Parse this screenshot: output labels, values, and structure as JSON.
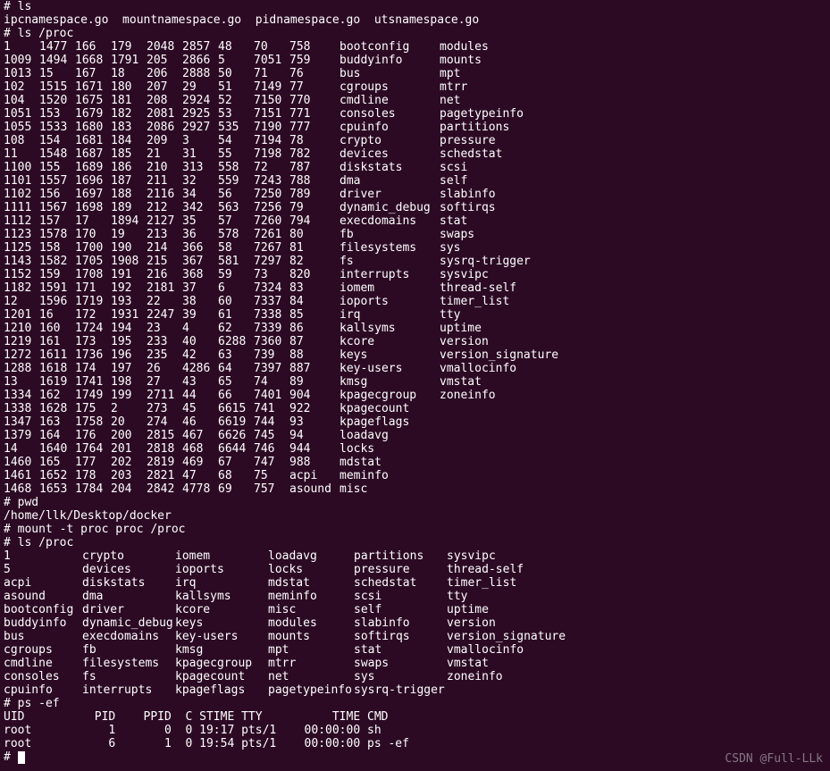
{
  "top_lines": [
    "# ls",
    "ipcnamespace.go  mountnamespace.go  pidnamespace.go  utsnamespace.go",
    "# ls /proc"
  ],
  "proc_cols": [
    [
      "1",
      "1009",
      "1013",
      "102",
      "104",
      "1051",
      "1055",
      "108",
      "11",
      "1100",
      "1101",
      "1102",
      "1111",
      "1112",
      "1123",
      "1125",
      "1143",
      "1152",
      "1182",
      "12",
      "1201",
      "1210",
      "1219",
      "1272",
      "1288",
      "13",
      "1334",
      "1338",
      "1347",
      "1379",
      "14",
      "1460",
      "1461",
      "1468"
    ],
    [
      "1477",
      "1494",
      "15",
      "1515",
      "1520",
      "153",
      "1533",
      "154",
      "1548",
      "155",
      "1557",
      "156",
      "1567",
      "157",
      "1578",
      "158",
      "1582",
      "159",
      "1591",
      "1596",
      "16",
      "160",
      "161",
      "1611",
      "1618",
      "1619",
      "162",
      "1628",
      "163",
      "164",
      "1640",
      "165",
      "1652",
      "1653"
    ],
    [
      "166",
      "1668",
      "167",
      "1671",
      "1675",
      "1679",
      "1680",
      "1681",
      "1687",
      "1689",
      "1696",
      "1697",
      "1698",
      "17",
      "170",
      "1700",
      "1705",
      "1708",
      "171",
      "1719",
      "172",
      "1724",
      "173",
      "1736",
      "174",
      "1741",
      "1749",
      "175",
      "1758",
      "176",
      "1764",
      "177",
      "178",
      "1784"
    ],
    [
      "179",
      "1791",
      "18",
      "180",
      "181",
      "182",
      "183",
      "184",
      "185",
      "186",
      "187",
      "188",
      "189",
      "1894",
      "19",
      "190",
      "1908",
      "191",
      "192",
      "193",
      "1931",
      "194",
      "195",
      "196",
      "197",
      "198",
      "199",
      "2",
      "20",
      "200",
      "201",
      "202",
      "203",
      "204"
    ],
    [
      "2048",
      "205",
      "206",
      "207",
      "208",
      "2081",
      "2086",
      "209",
      "21",
      "210",
      "211",
      "2116",
      "212",
      "2127",
      "213",
      "214",
      "215",
      "216",
      "2181",
      "22",
      "2247",
      "23",
      "233",
      "235",
      "26",
      "27",
      "2711",
      "273",
      "274",
      "2815",
      "2818",
      "2819",
      "2821",
      "2842"
    ],
    [
      "2857",
      "2866",
      "2888",
      "29",
      "2924",
      "2925",
      "2927",
      "3",
      "31",
      "313",
      "32",
      "34",
      "342",
      "35",
      "36",
      "366",
      "367",
      "368",
      "37",
      "38",
      "39",
      "4",
      "40",
      "42",
      "4286",
      "43",
      "44",
      "45",
      "46",
      "467",
      "468",
      "469",
      "47",
      "4778"
    ],
    [
      "48",
      "5",
      "50",
      "51",
      "52",
      "53",
      "535",
      "54",
      "55",
      "558",
      "559",
      "56",
      "563",
      "57",
      "578",
      "58",
      "581",
      "59",
      "6",
      "60",
      "61",
      "62",
      "6288",
      "63",
      "64",
      "65",
      "66",
      "6615",
      "6619",
      "6626",
      "6644",
      "67",
      "68",
      "69"
    ],
    [
      "70",
      "7051",
      "71",
      "7149",
      "7150",
      "7151",
      "7190",
      "7194",
      "7198",
      "72",
      "7243",
      "7250",
      "7256",
      "7260",
      "7261",
      "7267",
      "7297",
      "73",
      "7324",
      "7337",
      "7338",
      "7339",
      "7360",
      "739",
      "7397",
      "74",
      "7401",
      "741",
      "744",
      "745",
      "746",
      "747",
      "75",
      "757"
    ],
    [
      "758",
      "759",
      "76",
      "77",
      "770",
      "771",
      "777",
      "78",
      "782",
      "787",
      "788",
      "789",
      "79",
      "794",
      "80",
      "81",
      "82",
      "820",
      "83",
      "84",
      "85",
      "86",
      "87",
      "88",
      "887",
      "89",
      "904",
      "922",
      "93",
      "94",
      "944",
      "988",
      "acpi",
      "asound"
    ],
    [
      "bootconfig",
      "buddyinfo",
      "bus",
      "cgroups",
      "cmdline",
      "consoles",
      "cpuinfo",
      "crypto",
      "devices",
      "diskstats",
      "dma",
      "driver",
      "dynamic_debug",
      "execdomains",
      "fb",
      "filesystems",
      "fs",
      "interrupts",
      "iomem",
      "ioports",
      "irq",
      "kallsyms",
      "kcore",
      "keys",
      "key-users",
      "kmsg",
      "kpagecgroup",
      "kpagecount",
      "kpageflags",
      "loadavg",
      "locks",
      "mdstat",
      "meminfo",
      "misc"
    ],
    [
      "modules",
      "mounts",
      "mpt",
      "mtrr",
      "net",
      "pagetypeinfo",
      "partitions",
      "pressure",
      "schedstat",
      "scsi",
      "self",
      "slabinfo",
      "softirqs",
      "stat",
      "swaps",
      "sys",
      "sysrq-trigger",
      "sysvipc",
      "thread-self",
      "timer_list",
      "tty",
      "uptime",
      "version",
      "version_signature",
      "vmallocinfo",
      "vmstat",
      "zoneinfo",
      "",
      "",
      "",
      "",
      "",
      "",
      ""
    ]
  ],
  "proc_col_widths": [
    40,
    40,
    40,
    40,
    40,
    40,
    40,
    40,
    56,
    112,
    144
  ],
  "mid_lines": [
    "# pwd",
    "/home/llk/Desktop/docker",
    "# mount -t proc proc /proc",
    "# ls /proc"
  ],
  "proc2_cols": [
    [
      "1",
      "5",
      "acpi",
      "asound",
      "bootconfig",
      "buddyinfo",
      "bus",
      "cgroups",
      "cmdline",
      "consoles",
      "cpuinfo"
    ],
    [
      "crypto",
      "devices",
      "diskstats",
      "dma",
      "driver",
      "dynamic_debug",
      "execdomains",
      "fb",
      "filesystems",
      "fs",
      "interrupts"
    ],
    [
      "iomem",
      "ioports",
      "irq",
      "kallsyms",
      "kcore",
      "keys",
      "key-users",
      "kmsg",
      "kpagecgroup",
      "kpagecount",
      "kpageflags"
    ],
    [
      "loadavg",
      "locks",
      "mdstat",
      "meminfo",
      "misc",
      "modules",
      "mounts",
      "mpt",
      "mtrr",
      "net",
      "pagetypeinfo"
    ],
    [
      "partitions",
      "pressure",
      "schedstat",
      "scsi",
      "self",
      "slabinfo",
      "softirqs",
      "stat",
      "swaps",
      "sys",
      "sysrq-trigger"
    ],
    [
      "sysvipc",
      "thread-self",
      "timer_list",
      "tty",
      "uptime",
      "version",
      "version_signature",
      "vmallocinfo",
      "vmstat",
      "zoneinfo",
      ""
    ]
  ],
  "proc2_col_widths": [
    88,
    104,
    104,
    96,
    104,
    160
  ],
  "ps_header_line": "# ps -ef",
  "ps_header": "UID          PID    PPID  C STIME TTY          TIME CMD",
  "ps_rows": [
    "root           1       0  0 19:17 pts/1    00:00:00 sh",
    "root           6       1  0 19:54 pts/1    00:00:00 ps -ef"
  ],
  "prompt": "#",
  "watermark": "CSDN @Full-LLk"
}
